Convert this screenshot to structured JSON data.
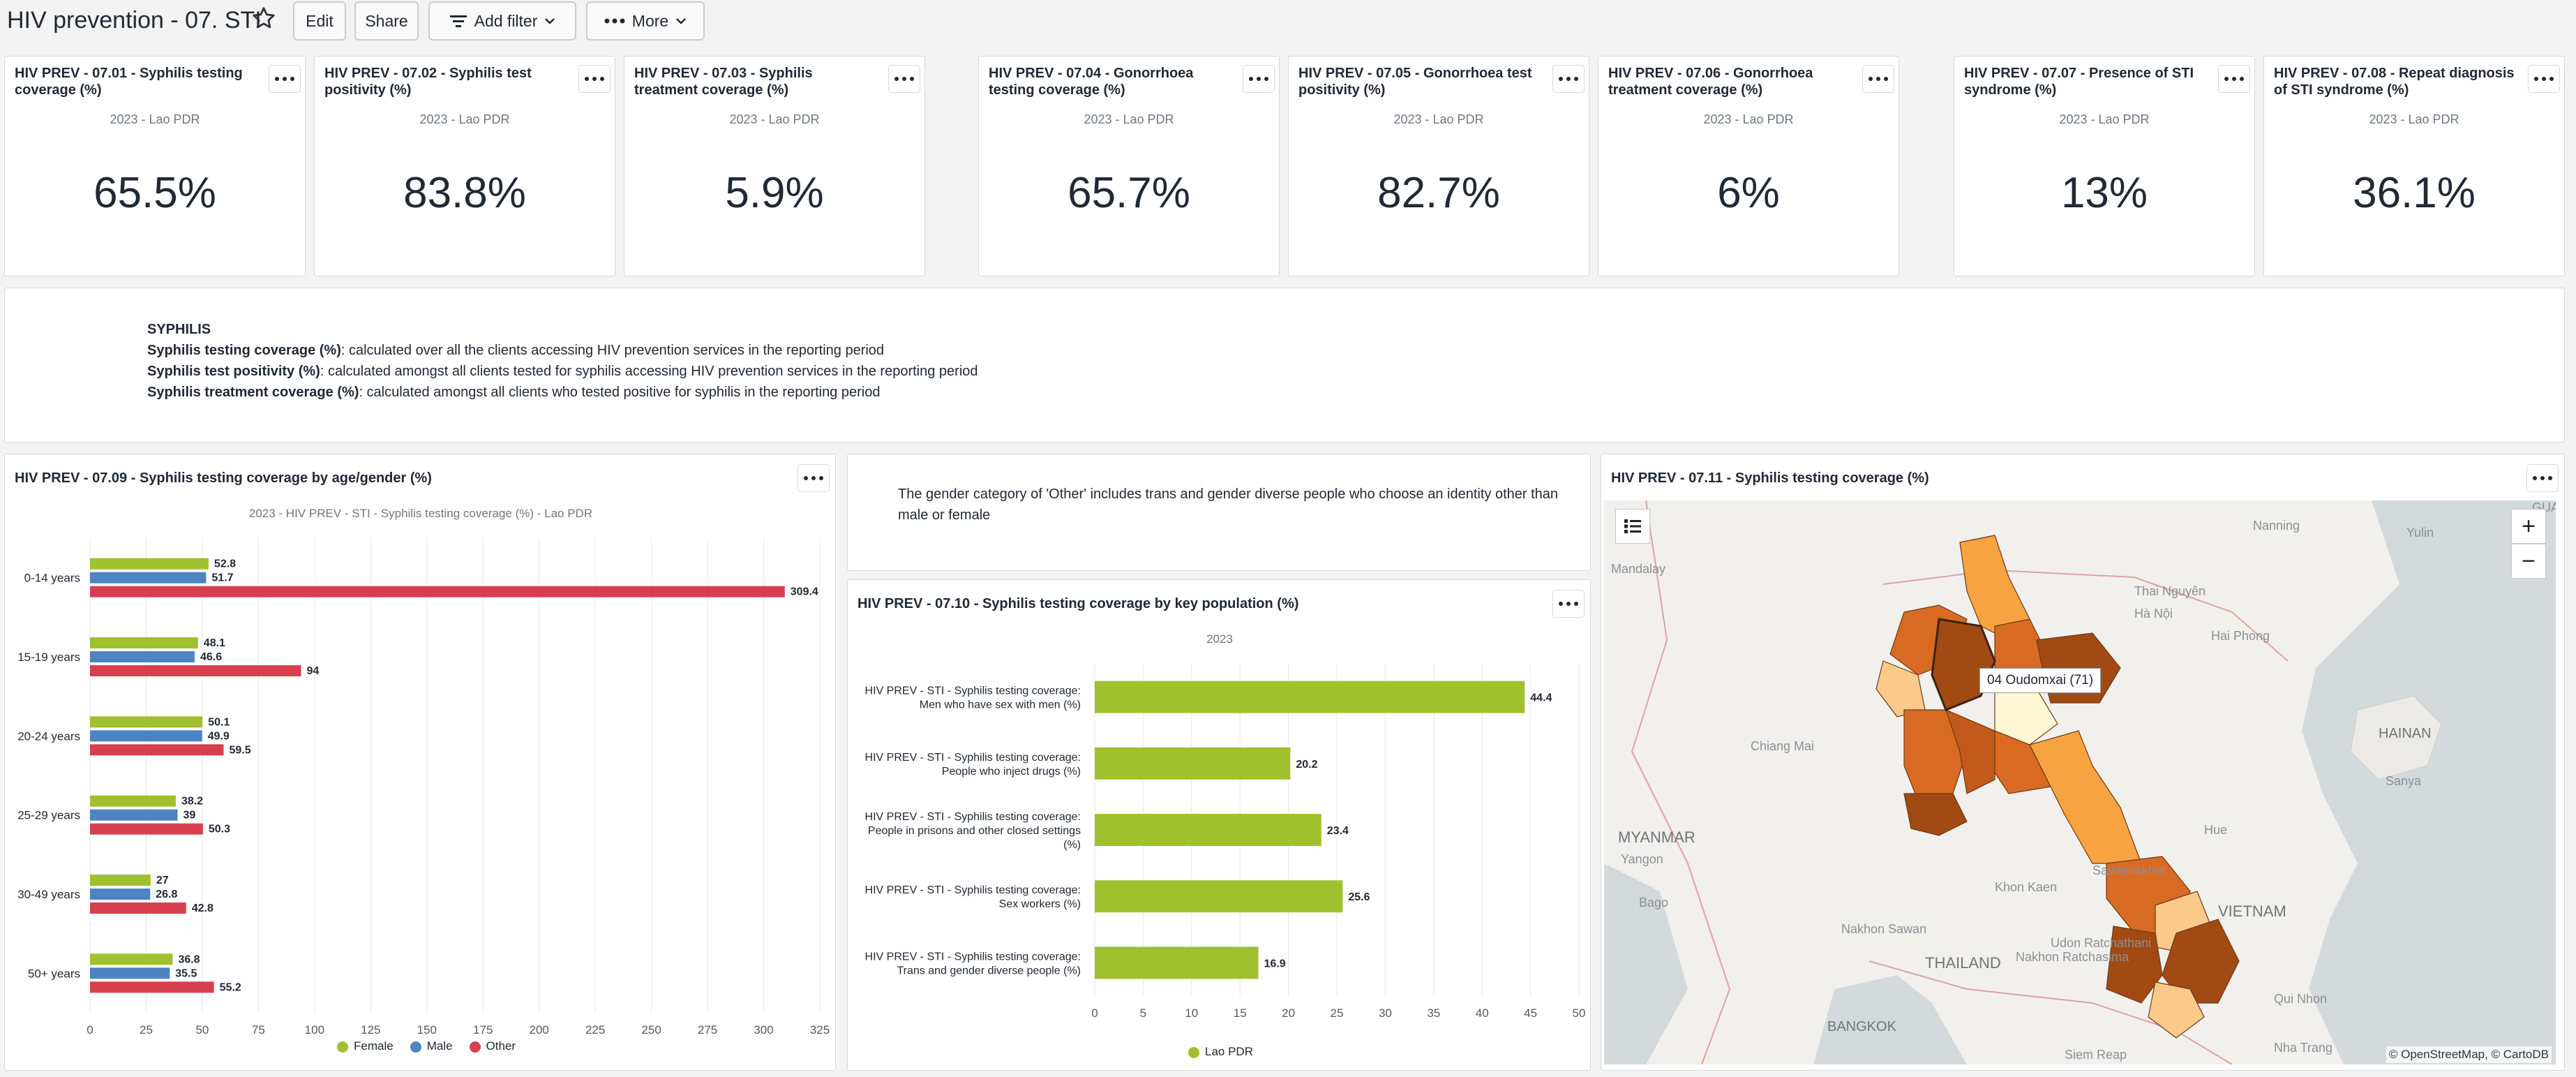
{
  "header": {
    "title": "HIV prevention - 07. STI",
    "edit_label": "Edit",
    "share_label": "Share",
    "add_filter_label": "Add filter",
    "more_label": "More"
  },
  "kpis": [
    {
      "title": "HIV PREV - 07.01 - Syphilis testing coverage (%)",
      "subtitle": "2023 - Lao PDR",
      "value": "65.5%"
    },
    {
      "title": "HIV PREV - 07.02 - Syphilis test positivity (%)",
      "subtitle": "2023 - Lao PDR",
      "value": "83.8%"
    },
    {
      "title": "HIV PREV - 07.03 - Syphilis treatment coverage (%)",
      "subtitle": "2023 - Lao PDR",
      "value": "5.9%"
    },
    {
      "title": "HIV PREV - 07.04 - Gonorrhoea testing coverage (%)",
      "subtitle": "2023 - Lao PDR",
      "value": "65.7%"
    },
    {
      "title": "HIV PREV - 07.05 - Gonorrhoea test positivity (%)",
      "subtitle": "2023 - Lao PDR",
      "value": "82.7%"
    },
    {
      "title": "HIV PREV - 07.06 - Gonorrhoea treatment coverage (%)",
      "subtitle": "2023 - Lao PDR",
      "value": "6%"
    },
    {
      "title": "HIV PREV - 07.07 - Presence of STI syndrome (%)",
      "subtitle": "2023 - Lao PDR",
      "value": "13%"
    },
    {
      "title": "HIV PREV - 07.08 - Repeat diagnosis of STI syndrome (%)",
      "subtitle": "2023 - Lao PDR",
      "value": "36.1%"
    }
  ],
  "syphilis_note": {
    "heading": "SYPHILIS",
    "lines": [
      {
        "term": "Syphilis testing coverage (%)",
        "text": ": calculated over all the clients accessing HIV prevention services in the reporting period"
      },
      {
        "term": "Syphilis test positivity (%)",
        "text": ": calculated amongst all clients tested for syphilis accessing HIV prevention services in the reporting period"
      },
      {
        "term": "Syphilis treatment coverage (%)",
        "text": ": calculated amongst all clients who tested positive for syphilis in the reporting period"
      }
    ]
  },
  "gender_note": {
    "text": "The gender category of 'Other' includes trans and gender diverse people who choose an identity other than male or female"
  },
  "colors": {
    "female": "#a1c02d",
    "male": "#4c84c4",
    "other": "#d6404e",
    "lao": "#a1c02d"
  },
  "chart_data": [
    {
      "type": "bar",
      "orientation": "horizontal",
      "title": "HIV PREV - 07.09 - Syphilis testing coverage by age/gender (%)",
      "subtitle": "2023 - HIV PREV - STI - Syphilis testing coverage (%) - Lao PDR",
      "categories": [
        "0-14 years",
        "15-19 years",
        "20-24 years",
        "25-29 years",
        "30-49 years",
        "50+ years"
      ],
      "series": [
        {
          "name": "Female",
          "color": "#a1c02d",
          "values": [
            52.8,
            48.1,
            50.1,
            38.2,
            27,
            36.8
          ]
        },
        {
          "name": "Male",
          "color": "#4c84c4",
          "values": [
            51.7,
            46.6,
            49.9,
            39,
            26.8,
            35.5
          ]
        },
        {
          "name": "Other",
          "color": "#d6404e",
          "values": [
            309.4,
            94,
            59.5,
            50.3,
            42.8,
            55.2
          ]
        }
      ],
      "xlim": [
        0,
        325
      ],
      "xticks": [
        0,
        25,
        50,
        75,
        100,
        125,
        150,
        175,
        200,
        225,
        250,
        275,
        300,
        325
      ],
      "grid": true,
      "legend": "bottom"
    },
    {
      "type": "bar",
      "orientation": "horizontal",
      "title": "HIV PREV - 07.10 - Syphilis testing coverage by key population (%)",
      "subtitle": "2023",
      "categories": [
        "HIV PREV - STI - Syphilis testing coverage: Men who have sex with men (%)",
        "HIV PREV - STI - Syphilis testing coverage: People who inject drugs (%)",
        "HIV PREV - STI - Syphilis testing coverage: People in prisons and other closed settings (%)",
        "HIV PREV - STI - Syphilis testing coverage: Sex workers (%)",
        "HIV PREV - STI - Syphilis testing coverage: Trans and gender diverse people (%)"
      ],
      "category_lines": [
        [
          "HIV PREV - STI - Syphilis testing coverage:",
          "Men who have sex with men (%)"
        ],
        [
          "HIV PREV - STI - Syphilis testing coverage:",
          "People who inject drugs (%)"
        ],
        [
          "HIV PREV - STI - Syphilis testing coverage:",
          "People in prisons and other closed settings",
          "(%)"
        ],
        [
          "HIV PREV - STI - Syphilis testing coverage:",
          "Sex workers (%)"
        ],
        [
          "HIV PREV - STI - Syphilis testing coverage:",
          "Trans and gender diverse people (%)"
        ]
      ],
      "series": [
        {
          "name": "Lao PDR",
          "color": "#a1c02d",
          "values": [
            44.4,
            20.2,
            23.4,
            25.6,
            16.9
          ]
        }
      ],
      "xlim": [
        0,
        50
      ],
      "xticks": [
        0,
        5,
        10,
        15,
        20,
        25,
        30,
        35,
        40,
        45,
        50
      ],
      "grid": true,
      "legend": "bottom"
    }
  ],
  "map": {
    "title": "HIV PREV - 07.11 - Syphilis testing coverage (%)",
    "tooltip": "04 Oudomxai (71)",
    "zoom_in": "+",
    "zoom_out": "−",
    "attribution": "© OpenStreetMap, © CartoDB",
    "places": [
      "Nanning",
      "Yulin",
      "Mandalay",
      "Thai Nguyên",
      "Hai Phong",
      "HAINAN",
      "Sanya",
      "Chiang Mai",
      "MYANMAR",
      "Yangon",
      "Khon Kaen",
      "Savannakhet",
      "Nakhon Sawan",
      "THAILAND",
      "Udon Ratchathani",
      "Nakhon Ratchasima",
      "BANGKOK",
      "Siem Reap",
      "Hue",
      "VIETNAM",
      "Qui Nhon",
      "Nha Trang",
      "Bago",
      "GUA",
      "Hà Nội"
    ]
  }
}
